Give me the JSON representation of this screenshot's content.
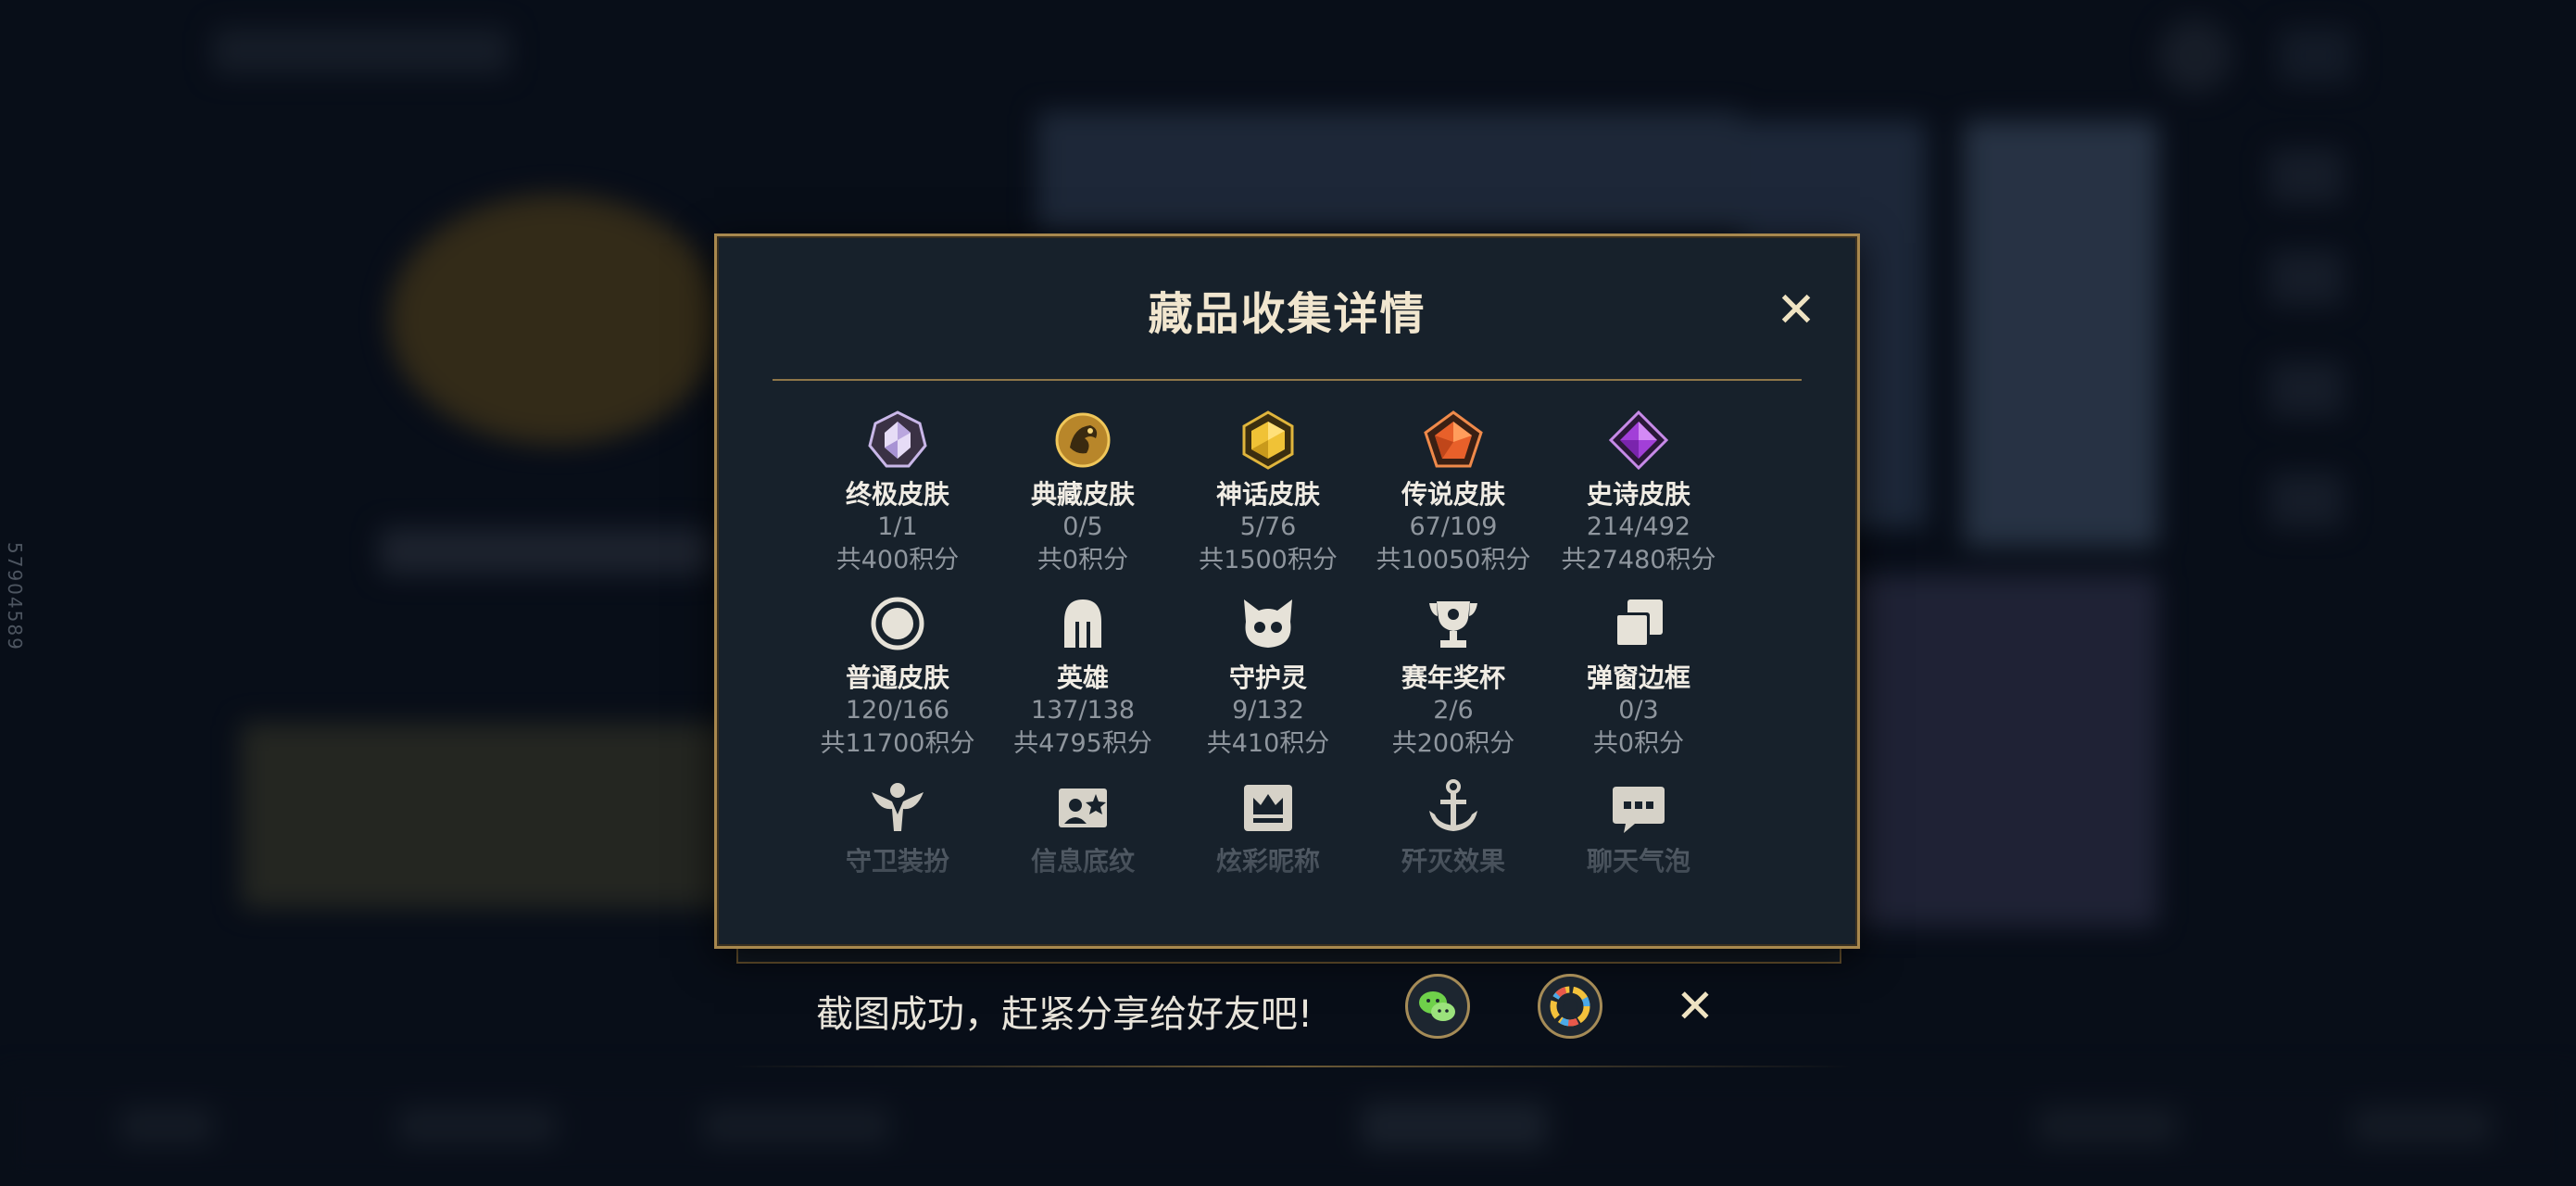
{
  "modal": {
    "title": "藏品收集详情",
    "close_icon": "close-icon",
    "items": [
      {
        "icon": "ultimate-skin-icon",
        "label": "终极皮肤",
        "count": "1/1",
        "points": "共400积分"
      },
      {
        "icon": "prestige-skin-icon",
        "label": "典藏皮肤",
        "count": "0/5",
        "points": "共0积分"
      },
      {
        "icon": "mythic-skin-icon",
        "label": "神话皮肤",
        "count": "5/76",
        "points": "共1500积分"
      },
      {
        "icon": "legendary-skin-icon",
        "label": "传说皮肤",
        "count": "67/109",
        "points": "共10050积分"
      },
      {
        "icon": "epic-skin-icon",
        "label": "史诗皮肤",
        "count": "214/492",
        "points": "共27480积分"
      },
      {
        "icon": "normal-skin-icon",
        "label": "普通皮肤",
        "count": "120/166",
        "points": "共11700积分"
      },
      {
        "icon": "champion-helmet-icon",
        "label": "英雄",
        "count": "137/138",
        "points": "共4795积分"
      },
      {
        "icon": "little-legend-icon",
        "label": "守护灵",
        "count": "9/132",
        "points": "共410积分"
      },
      {
        "icon": "trophy-icon",
        "label": "赛年奖杯",
        "count": "2/6",
        "points": "共200积分"
      },
      {
        "icon": "popup-frame-icon",
        "label": "弹窗边框",
        "count": "0/3",
        "points": "共0积分"
      },
      {
        "icon": "ward-skin-icon",
        "label": "守卫装扮",
        "count": "",
        "points": ""
      },
      {
        "icon": "profile-banner-icon",
        "label": "信息底纹",
        "count": "",
        "points": ""
      },
      {
        "icon": "nameplate-icon",
        "label": "炫彩昵称",
        "count": "",
        "points": ""
      },
      {
        "icon": "finisher-effect-icon",
        "label": "歼灭效果",
        "count": "",
        "points": ""
      },
      {
        "icon": "chat-bubble-icon",
        "label": "聊天气泡",
        "count": "",
        "points": ""
      }
    ]
  },
  "share": {
    "message": "截图成功，赶紧分享给好友吧!",
    "wechat_icon": "wechat-icon",
    "moments_icon": "moments-icon",
    "close_icon": "close-icon"
  },
  "side_code": "57904589",
  "colors": {
    "accent_gold": "#a8884e",
    "panel_bg": "#17212b",
    "text_muted": "#8f969e"
  }
}
